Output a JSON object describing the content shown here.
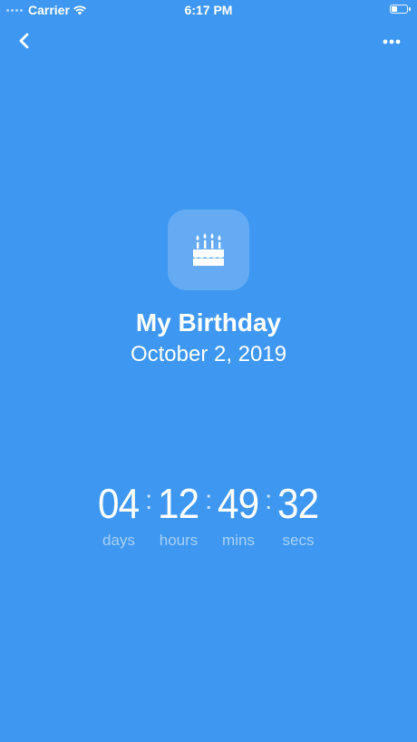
{
  "status_bar": {
    "carrier": "Carrier",
    "time": "6:17 PM",
    "battery_level": 0.4
  },
  "nav": {
    "back_icon": "chevron-left-icon",
    "more_icon": "ellipsis-icon"
  },
  "event": {
    "icon": "birthday-cake-icon",
    "title": "My Birthday",
    "date": "October 2, 2019"
  },
  "countdown": {
    "days": "04",
    "hours": "12",
    "mins": "49",
    "secs": "32",
    "separator": ":",
    "labels": {
      "days": "days",
      "hours": "hours",
      "mins": "mins",
      "secs": "secs"
    }
  },
  "colors": {
    "background": "#3e97f0",
    "text": "#ffffff"
  }
}
